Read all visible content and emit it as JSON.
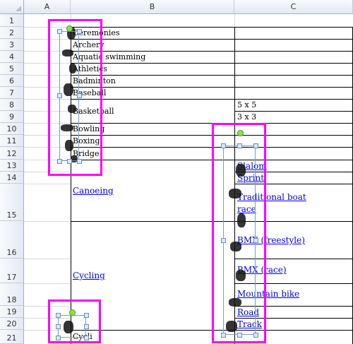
{
  "columns": [
    "A",
    "B",
    "C"
  ],
  "rows": [
    "1",
    "2",
    "3",
    "4",
    "5",
    "6",
    "7",
    "8",
    "9",
    "10",
    "11",
    "12",
    "13",
    "14",
    "15",
    "16",
    "17",
    "18",
    "19",
    "20",
    "21"
  ],
  "cells": {
    "b2": "Ceremonies",
    "b3": "Archery",
    "b4": "Aquatic swimming",
    "b5": "Athletics",
    "b6": "Badminton",
    "b7": "Baseball",
    "b8": "Basketball",
    "c8": "5 x 5",
    "c9": "3 x 3",
    "b10": "Bowling",
    "b11": "Boxing",
    "b12": "Bridge",
    "b21": "Cycli"
  },
  "links": {
    "canoeing": "Canoeing",
    "cycling": "Cycling",
    "slalom": "Slalom",
    "sprint": "Sprint",
    "traditional_boat_1": "Traditional boat",
    "traditional_boat_2": "race",
    "bmx_freestyle": "BMX (freestyle)",
    "bmx_race": "BMX (race)",
    "mountain_bike": "Mountain bike",
    "road": "Road",
    "track": "Track"
  },
  "highlight_color": "#ff00ff"
}
